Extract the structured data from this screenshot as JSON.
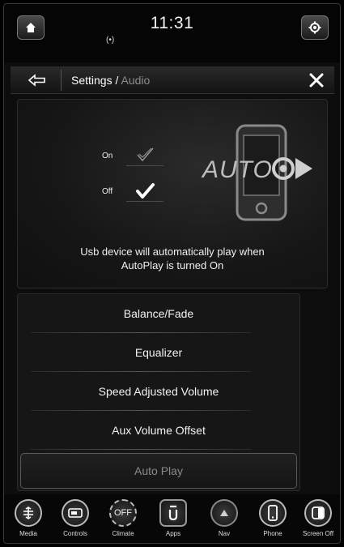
{
  "status": {
    "time": "11:31",
    "signal_glyph": "(•)"
  },
  "header": {
    "breadcrumb_root": "Settings",
    "breadcrumb_sep": " / ",
    "breadcrumb_page": "Audio"
  },
  "autoplay": {
    "on_label": "On",
    "off_label": "Off",
    "selected": "Off",
    "logo_text": "AUTO",
    "description_line1": "Usb device will automatically play when",
    "description_line2": "AutoPlay is turned On"
  },
  "menu": {
    "items": [
      {
        "label": "Balance/Fade"
      },
      {
        "label": "Equalizer"
      },
      {
        "label": "Speed Adjusted Volume"
      },
      {
        "label": "Aux Volume Offset"
      },
      {
        "label": "Auto Play"
      }
    ],
    "selected_index": 4
  },
  "dock": {
    "items": [
      {
        "label": "Media",
        "icon": "media-icon"
      },
      {
        "label": "Controls",
        "icon": "controls-icon"
      },
      {
        "label": "Climate",
        "icon": "climate-icon",
        "text": "OFF"
      },
      {
        "label": "Apps",
        "icon": "apps-icon"
      },
      {
        "label": "Nav",
        "icon": "nav-icon"
      },
      {
        "label": "Phone",
        "icon": "phone-icon"
      },
      {
        "label": "Screen Off",
        "icon": "screen-off-icon"
      }
    ]
  },
  "colors": {
    "background": "#0d0d0d",
    "text": "#f2f2f2",
    "muted_text": "#8c8c8c",
    "border": "#5a5a5a"
  }
}
